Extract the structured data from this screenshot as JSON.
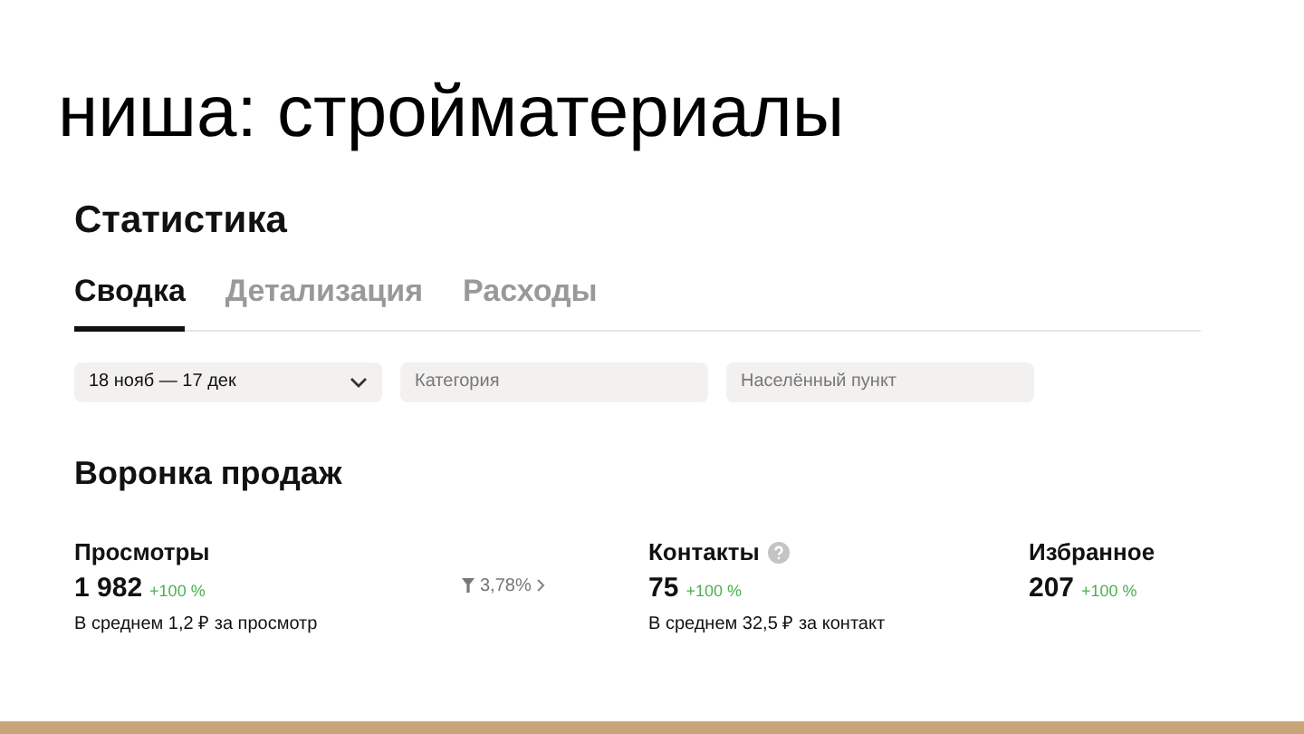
{
  "slide_title": "ниша: стройматериалы",
  "page": {
    "title": "Статистика",
    "tabs": [
      {
        "label": "Сводка",
        "selected": true
      },
      {
        "label": "Детализация",
        "selected": false
      },
      {
        "label": "Расходы",
        "selected": false
      }
    ],
    "filters": [
      {
        "kind": "dropdown",
        "value": "18 нояб — 17 дек"
      },
      {
        "kind": "field",
        "placeholder": "Категория"
      },
      {
        "kind": "field",
        "placeholder": "Населённый пункт"
      }
    ],
    "funnel": {
      "title": "Воронка продаж",
      "items": [
        {
          "kind": "metric",
          "label": "Просмотры",
          "help": false,
          "value": "1 982",
          "change": "+100 %",
          "note": "В среднем 1,2 ₽ за просмотр"
        },
        {
          "kind": "conversion",
          "value": "3,78%"
        },
        {
          "kind": "metric",
          "label": "Контакты",
          "help": true,
          "value": "75",
          "change": "+100 %",
          "note": "В среднем 32,5 ₽ за контакт"
        },
        {
          "kind": "metric",
          "label": "Избранное",
          "help": false,
          "value": "207",
          "change": "+100 %"
        }
      ]
    }
  }
}
